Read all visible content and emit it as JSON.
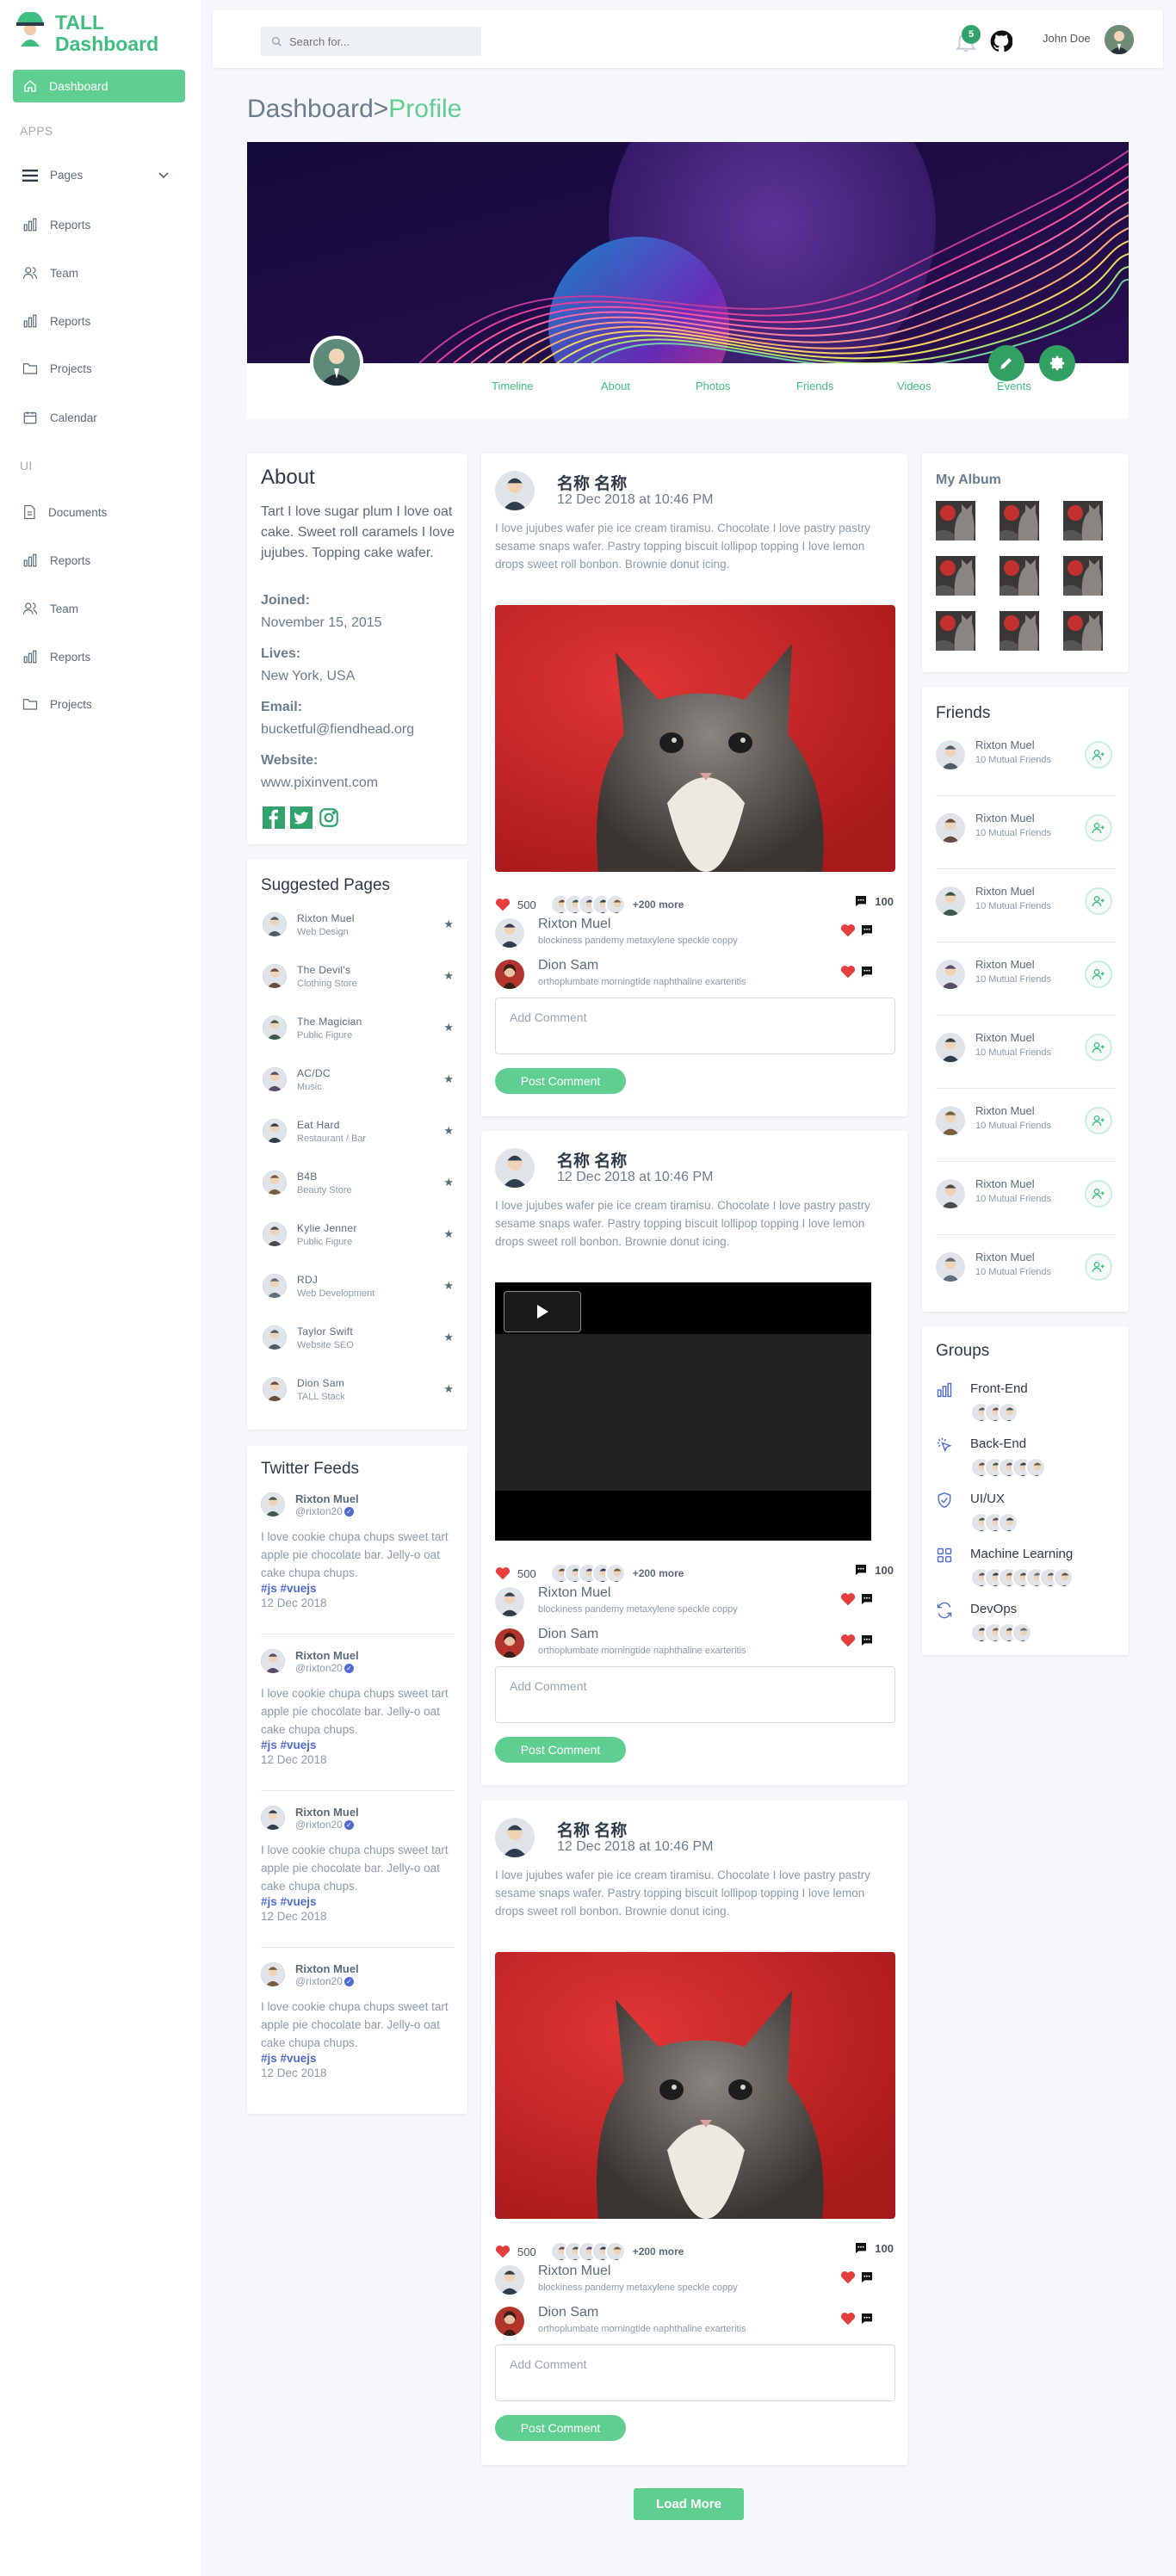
{
  "brand": {
    "line1": "TALL",
    "line2": "Dashboard"
  },
  "sidebar": {
    "active": "Dashboard",
    "section_apps": "APPS",
    "apps": [
      "Pages",
      "Reports",
      "Team",
      "Reports",
      "Projects",
      "Calendar"
    ],
    "section_ui": "UI",
    "ui": [
      "Documents",
      "Reports",
      "Team",
      "Reports",
      "Projects"
    ]
  },
  "topbar": {
    "search_placeholder": "Search for...",
    "notification_count": "5",
    "user_name": "John Doe"
  },
  "breadcrumb": {
    "root": "Dashboard",
    "sep": ">",
    "current": "Profile"
  },
  "profile_tabs": [
    "Timeline",
    "About",
    "Photos",
    "Friends",
    "Videos",
    "Events"
  ],
  "about": {
    "title": "About",
    "bio": "Tart I love sugar plum I love oat cake. Sweet roll caramels I love jujubes. Topping cake wafer.",
    "joined_label": "Joined:",
    "joined": "November 15, 2015",
    "lives_label": "Lives:",
    "lives": "New York, USA",
    "email_label": "Email:",
    "email": "bucketful@fiendhead.org",
    "website_label": "Website:",
    "website": "www.pixinvent.com"
  },
  "suggested": {
    "title": "Suggested Pages",
    "items": [
      {
        "name": "Rixton Muel",
        "sub": "Web Design"
      },
      {
        "name": "The Devil's",
        "sub": "Clothing Store"
      },
      {
        "name": "The Magician",
        "sub": "Public Figure"
      },
      {
        "name": "AC/DC",
        "sub": "Music"
      },
      {
        "name": "Eat Hard",
        "sub": "Restaurant / Bar"
      },
      {
        "name": "B4B",
        "sub": "Beauty Store"
      },
      {
        "name": "Kylie Jenner",
        "sub": "Public Figure"
      },
      {
        "name": "RDJ",
        "sub": "Web Development"
      },
      {
        "name": "Taylor Swift",
        "sub": "Website SEO"
      },
      {
        "name": "Dion Sam",
        "sub": "TALL Stack"
      }
    ]
  },
  "twitter": {
    "title": "Twitter Feeds",
    "items": [
      {
        "name": "Rixton Muel",
        "handle": "@rixton20",
        "body": "I love cookie chupa chups sweet tart apple pie chocolate bar. Jelly-o oat cake chupa chups.",
        "tags": "#js #vuejs",
        "date": "12 Dec 2018"
      },
      {
        "name": "Rixton Muel",
        "handle": "@rixton20",
        "body": "I love cookie chupa chups sweet tart apple pie chocolate bar. Jelly-o oat cake chupa chups.",
        "tags": "#js #vuejs",
        "date": "12 Dec 2018"
      },
      {
        "name": "Rixton Muel",
        "handle": "@rixton20",
        "body": "I love cookie chupa chups sweet tart apple pie chocolate bar. Jelly-o oat cake chupa chups.",
        "tags": "#js #vuejs",
        "date": "12 Dec 2018"
      },
      {
        "name": "Rixton Muel",
        "handle": "@rixton20",
        "body": "I love cookie chupa chups sweet tart apple pie chocolate bar. Jelly-o oat cake chupa chups.",
        "tags": "#js #vuejs",
        "date": "12 Dec 2018"
      }
    ]
  },
  "posts": [
    {
      "author": "名称 名称",
      "date": "12 Dec 2018 at 10:46 PM",
      "body": "I love jujubes wafer pie ice cream tiramisu. Chocolate I love pastry pastry sesame snaps wafer. Pastry topping biscuit lollipop topping I love lemon drops sweet roll bonbon. Brownie donut icing.",
      "media": "image",
      "likes": "500",
      "more": "+200 more",
      "comments": "100",
      "c1": {
        "name": "Rixton Muel",
        "text": "blockiness pandemy metaxylene speckle coppy"
      },
      "c2": {
        "name": "Dion Sam",
        "text": "orthoplumbate morningtide naphthaline exarteritis"
      },
      "placeholder": "Add Comment",
      "button": "Post Comment"
    },
    {
      "author": "名称 名称",
      "date": "12 Dec 2018 at 10:46 PM",
      "body": "I love jujubes wafer pie ice cream tiramisu. Chocolate I love pastry pastry sesame snaps wafer. Pastry topping biscuit lollipop topping I love lemon drops sweet roll bonbon. Brownie donut icing.",
      "media": "video",
      "likes": "500",
      "more": "+200 more",
      "comments": "100",
      "c1": {
        "name": "Rixton Muel",
        "text": "blockiness pandemy metaxylene speckle coppy"
      },
      "c2": {
        "name": "Dion Sam",
        "text": "orthoplumbate morningtide naphthaline exarteritis"
      },
      "placeholder": "Add Comment",
      "button": "Post Comment"
    },
    {
      "author": "名称 名称",
      "date": "12 Dec 2018 at 10:46 PM",
      "body": "I love jujubes wafer pie ice cream tiramisu. Chocolate I love pastry pastry sesame snaps wafer. Pastry topping biscuit lollipop topping I love lemon drops sweet roll bonbon. Brownie donut icing.",
      "media": "image",
      "likes": "500",
      "more": "+200 more",
      "comments": "100",
      "c1": {
        "name": "Rixton Muel",
        "text": "blockiness pandemy metaxylene speckle coppy"
      },
      "c2": {
        "name": "Dion Sam",
        "text": "orthoplumbate morningtide naphthaline exarteritis"
      },
      "placeholder": "Add Comment",
      "button": "Post Comment"
    }
  ],
  "album": {
    "title": "My Album"
  },
  "friends": {
    "title": "Friends",
    "items": [
      {
        "name": "Rixton Muel",
        "sub": "10 Mutual Friends"
      },
      {
        "name": "Rixton Muel",
        "sub": "10 Mutual Friends"
      },
      {
        "name": "Rixton Muel",
        "sub": "10 Mutual Friends"
      },
      {
        "name": "Rixton Muel",
        "sub": "10 Mutual Friends"
      },
      {
        "name": "Rixton Muel",
        "sub": "10 Mutual Friends"
      },
      {
        "name": "Rixton Muel",
        "sub": "10 Mutual Friends"
      },
      {
        "name": "Rixton Muel",
        "sub": "10 Mutual Friends"
      },
      {
        "name": "Rixton Muel",
        "sub": "10 Mutual Friends"
      }
    ]
  },
  "groups": {
    "title": "Groups",
    "items": [
      {
        "name": "Front-End",
        "icon": "bar-chart-icon"
      },
      {
        "name": "Back-End",
        "icon": "cursor-click-icon"
      },
      {
        "name": "UI/UX",
        "icon": "shield-check-icon"
      },
      {
        "name": "Machine Learning",
        "icon": "grid-icon"
      },
      {
        "name": "DevOps",
        "icon": "refresh-icon"
      }
    ]
  },
  "load_more": "Load More",
  "colors": {
    "accent": "#5fcf8f",
    "accent_dark": "#3fbf7f",
    "heart": "#e53e3e"
  }
}
